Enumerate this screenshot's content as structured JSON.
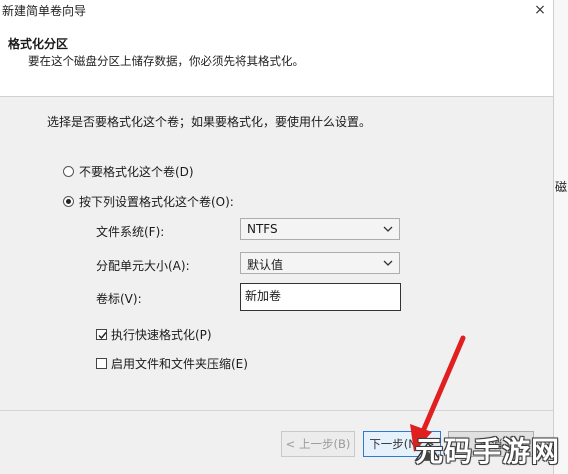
{
  "window": {
    "title": "新建简单卷向导",
    "close_glyph": "×",
    "right_edge_letter": "磁"
  },
  "header": {
    "title": "格式化分区",
    "subtitle": "要在这个磁盘分区上储存数据，你必须先将其格式化。"
  },
  "content": {
    "question": "选择是否要格式化这个卷；如果要格式化，要使用什么设置。",
    "radio_no_format": {
      "label": "不要格式化这个卷(D)",
      "checked": false
    },
    "radio_format": {
      "label": "按下列设置格式化这个卷(O):",
      "checked": true
    },
    "filesystem": {
      "label": "文件系统(F):",
      "value": "NTFS"
    },
    "allocation": {
      "label": "分配单元大小(A):",
      "value": "默认值"
    },
    "volume_label": {
      "label": "卷标(V):",
      "value": "新加卷"
    },
    "quick_format": {
      "label": "执行快速格式化(P)",
      "checked": true
    },
    "compression": {
      "label": "启用文件和文件夹压缩(E)",
      "checked": false
    }
  },
  "buttons": {
    "back": "< 上一步(B)",
    "next": "下一步(N) >",
    "cancel": "取消"
  },
  "annotation": {
    "arrow_color": "#e02020"
  },
  "watermark": {
    "text": "元码手游网"
  }
}
